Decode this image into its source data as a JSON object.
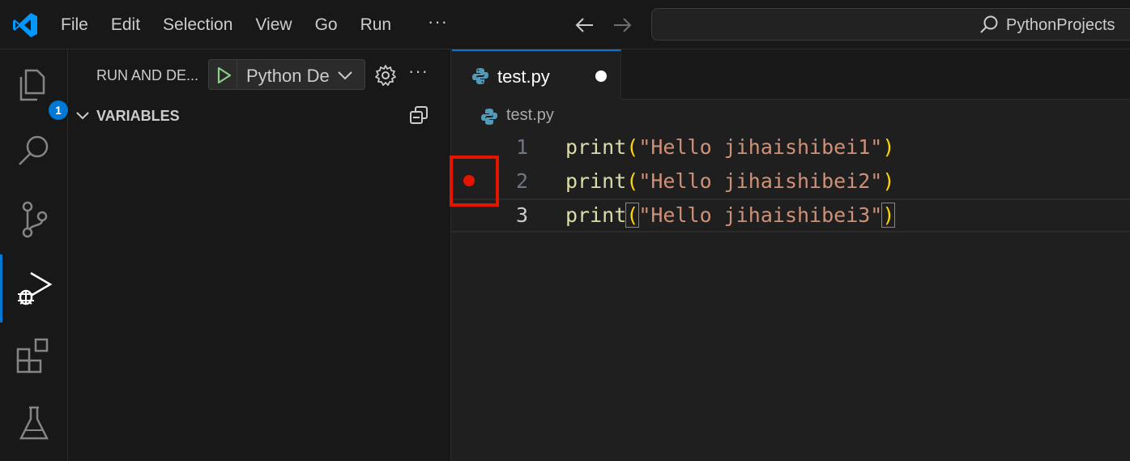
{
  "titlebar": {
    "menu": [
      "File",
      "Edit",
      "Selection",
      "View",
      "Go",
      "Run"
    ],
    "more": "···",
    "search_label": "PythonProjects"
  },
  "activity": {
    "explorer_badge": "1",
    "icons": [
      "files-icon",
      "search-icon",
      "source-control-icon",
      "run-debug-icon",
      "extensions-icon",
      "testing-icon"
    ],
    "active": "run-debug-icon"
  },
  "sidebar": {
    "title": "RUN AND DE...",
    "run_config": "Python De",
    "more": "···",
    "section_title": "VARIABLES"
  },
  "editor": {
    "tab_label": "test.py",
    "breadcrumb": "test.py",
    "breakpoint_line": 2,
    "lines": [
      {
        "num": "1",
        "fn": "print",
        "open": "(",
        "str": "\"Hello jihaishibei1\"",
        "close": ")"
      },
      {
        "num": "2",
        "fn": "print",
        "open": "(",
        "str": "\"Hello jihaishibei2\"",
        "close": ")"
      },
      {
        "num": "3",
        "fn": "print",
        "open": "(",
        "str": "\"Hello jihaishibei3\"",
        "close": ")"
      }
    ]
  },
  "colors": {
    "accent": "#0078d4",
    "breakpoint": "#e51400",
    "function": "#dcdcaa",
    "string": "#ce9178",
    "bracket": "#ffd700"
  }
}
